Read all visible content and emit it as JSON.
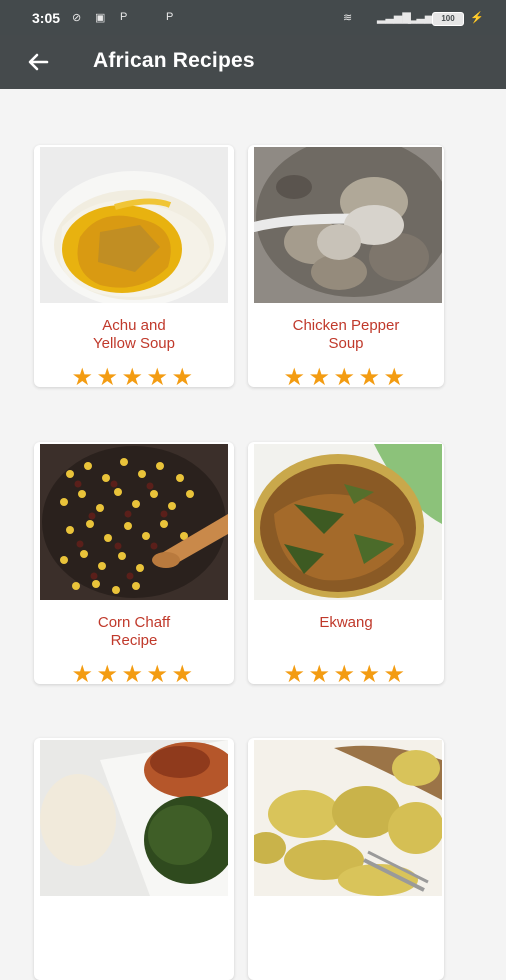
{
  "status_bar": {
    "time": "3:05",
    "battery": "100"
  },
  "app_bar": {
    "title": "African Recipes"
  },
  "recipes": [
    {
      "name": "Achu and\nYellow Soup",
      "rating": 5
    },
    {
      "name": "Chicken Pepper\nSoup",
      "rating": 5
    },
    {
      "name": "Corn Chaff\nRecipe",
      "rating": 5
    },
    {
      "name": "Ekwang",
      "rating": 5
    },
    {
      "name": "",
      "rating": 0
    },
    {
      "name": "",
      "rating": 0
    }
  ],
  "colors": {
    "app_bar": "#454a4c",
    "recipe_name": "#c0392b",
    "star": "#f39c12"
  },
  "icons": [
    "back-arrow-icon",
    "star-icon"
  ]
}
